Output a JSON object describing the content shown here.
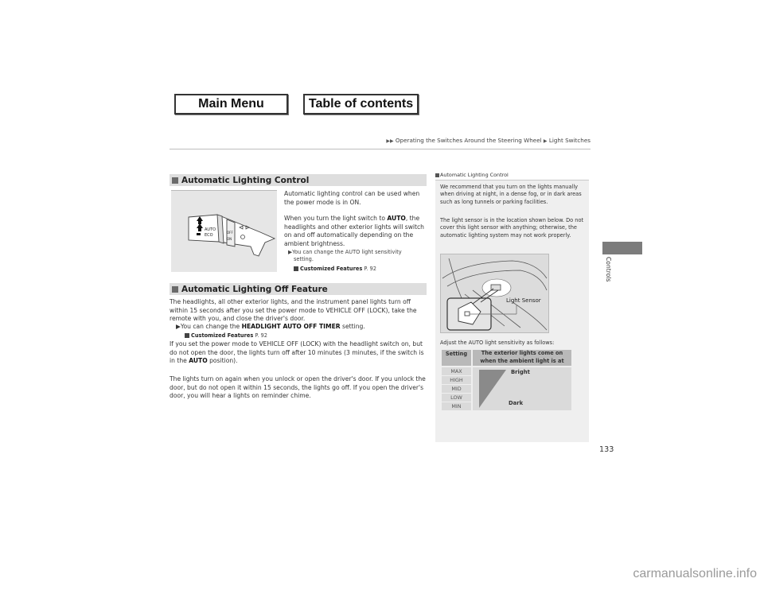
{
  "nav": {
    "main_menu": "Main Menu",
    "table_of_contents": "Table of contents"
  },
  "breadcrumb": {
    "items": [
      "Operating the Switches Around the Steering Wheel",
      "Light Switches"
    ],
    "separator_icon": "triangle-right-icon"
  },
  "section1": {
    "title": "Automatic Lighting Control",
    "figure": "light-switch-lever-illustration",
    "figure_labels": [
      "AUTO",
      "ECO",
      "OFF",
      "ON"
    ],
    "p1": "Automatic lighting control can be used when the power mode is in ON.",
    "p2_before": "When you turn the light switch to ",
    "p2_bold": "AUTO",
    "p2_after": ", the headlights and other exterior lights will switch on and off automatically depending on the ambient brightness.",
    "note_line1": "You can change the AUTO light sensitivity",
    "note_line2": "setting.",
    "xref_label": "Customized Features",
    "xref_page": "P. 92"
  },
  "section2": {
    "title": "Automatic Lighting Off Feature",
    "p1": "The headlights, all other exterior lights, and the instrument panel lights turn off within 15 seconds after you set the power mode to VEHICLE OFF (LOCK), take the remote with you, and close the driver's door.",
    "note_before": "You can change the ",
    "note_bold": "HEADLIGHT AUTO OFF TIMER",
    "note_after": " setting.",
    "xref_label": "Customized Features",
    "xref_page": "P. 92",
    "p2_before": "If you set the power mode to VEHICLE OFF (LOCK) with the headlight switch on, but do not open the door, the lights turn off after 10 minutes (3 minutes, if the switch is in the ",
    "p2_bold": "AUTO",
    "p2_after": " position).",
    "p3": "The lights turn on again when you unlock or open the driver's door. If you unlock the door, but do not open it within 15 seconds, the lights go off. If you open the driver's door, you will hear a lights on reminder chime."
  },
  "sidebar": {
    "title": "Automatic Lighting Control",
    "p1": "We recommend that you turn on the lights manually when driving at night, in a dense fog, or in dark areas such as long tunnels or parking facilities.",
    "p2": "The light sensor is in the location shown below. Do not cover this light sensor with anything; otherwise, the automatic lighting system may not work properly.",
    "figure_label": "Light Sensor",
    "p3": "Adjust the AUTO light sensitivity as follows:",
    "table": {
      "header_setting": "Setting",
      "header_ext_line1": "The exterior lights come on",
      "header_ext_line2": "when the ambient light is at",
      "settings": [
        "MAX",
        "HIGH",
        "MID",
        "LOW",
        "MIN"
      ],
      "bright_label": "Bright",
      "dark_label": "Dark"
    }
  },
  "tab": {
    "label": "Controls"
  },
  "page_number": "133",
  "watermark": "carmanualsonline.info"
}
